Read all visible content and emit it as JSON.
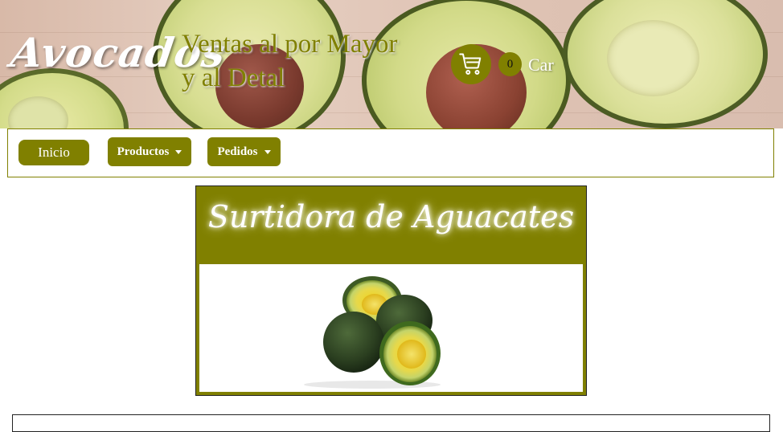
{
  "header": {
    "logo": "Avocados",
    "tagline_line1": "Ventas al por Mayor",
    "tagline_line2": "y al Detal",
    "cart_count": "0",
    "cart_label": "Car",
    "cart_icon": "shopping-cart-icon"
  },
  "nav": {
    "inicio": "Inicio",
    "productos": "Productos",
    "pedidos": "Pedidos"
  },
  "hero": {
    "title": "Surtidora de Aguacates"
  },
  "colors": {
    "accent": "#808000",
    "text_light": "#ffffff"
  }
}
